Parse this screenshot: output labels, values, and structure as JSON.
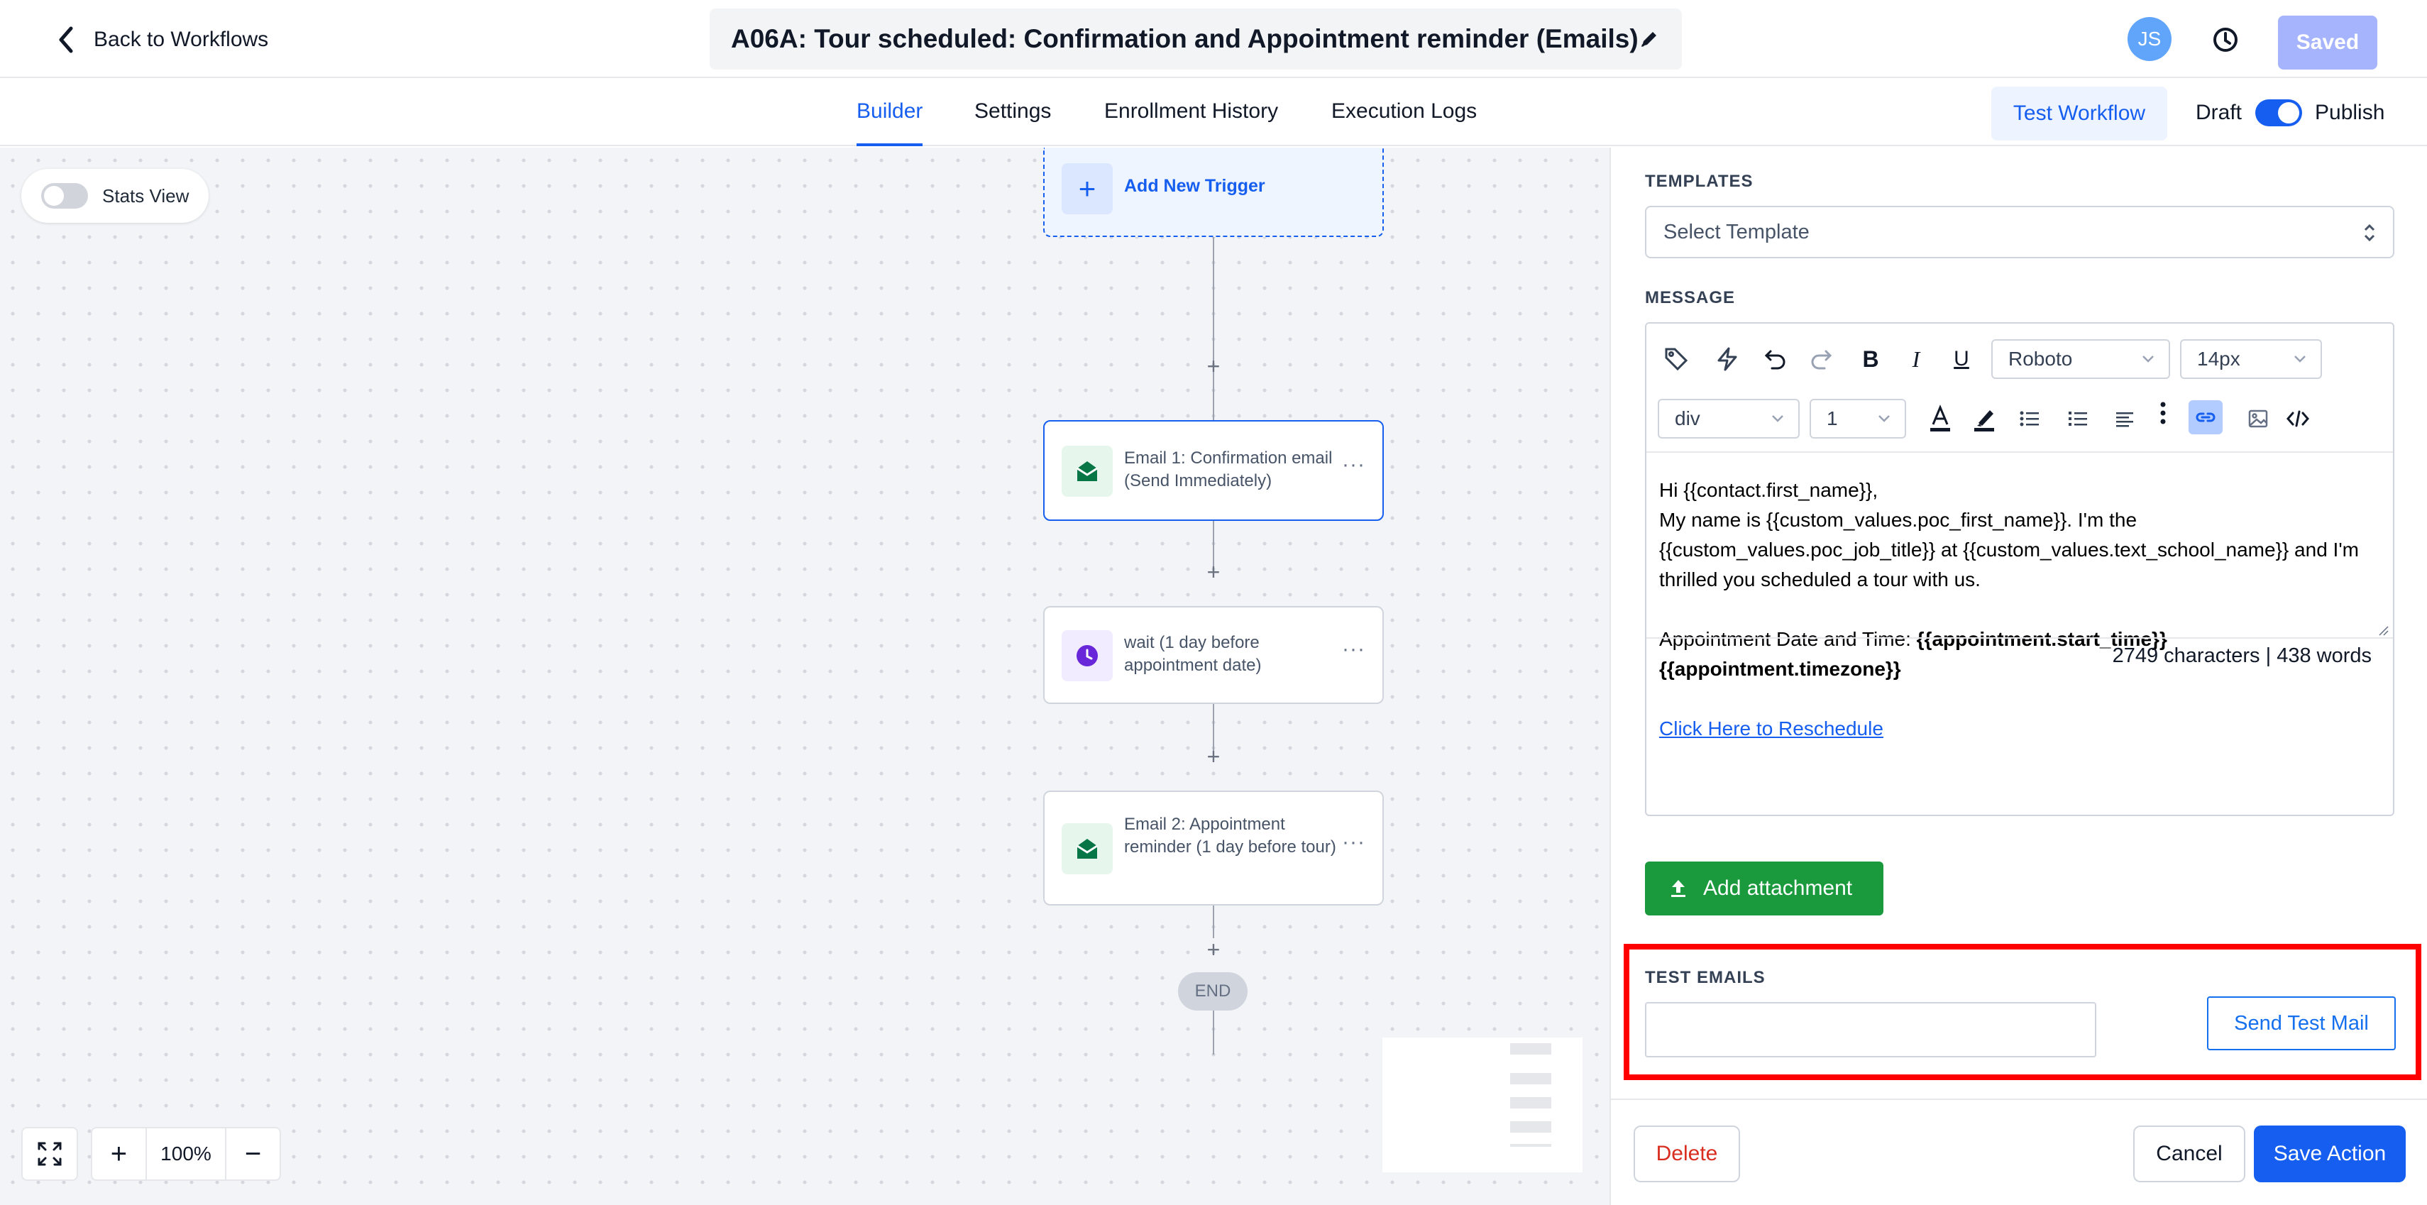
{
  "header": {
    "back_label": "Back to Workflows",
    "title": "A06A: Tour scheduled: Confirmation and Appointment reminder (Emails)",
    "avatar_initials": "JS",
    "saved_label": "Saved"
  },
  "tabs": [
    {
      "label": "Builder",
      "active": true
    },
    {
      "label": "Settings",
      "active": false
    },
    {
      "label": "Enrollment History",
      "active": false
    },
    {
      "label": "Execution Logs",
      "active": false
    }
  ],
  "tabbar_right": {
    "test_workflow_label": "Test Workflow",
    "draft_label": "Draft",
    "publish_label": "Publish",
    "published": true
  },
  "canvas": {
    "stats_view_label": "Stats View",
    "stats_view_on": false,
    "add_trigger_label": "Add New Trigger",
    "nodes": [
      {
        "text": "Email 1: Confirmation email (Send Immediately)",
        "icon": "email-icon",
        "selected": true
      },
      {
        "text": "wait (1 day before appointment date)",
        "icon": "clock-icon",
        "selected": false
      },
      {
        "text": "Email 2: Appointment reminder (1 day before tour)",
        "icon": "email-icon",
        "selected": false
      }
    ],
    "plus_symbol": "+",
    "more_symbol": "···",
    "end_label": "END",
    "zoom_level": "100%"
  },
  "panel": {
    "templates_label": "TEMPLATES",
    "template_placeholder": "Select Template",
    "message_label": "MESSAGE",
    "font_family_value": "Roboto",
    "font_size_value": "14px",
    "block_type_value": "div",
    "line_height_value": "1",
    "message_lines": {
      "greeting": "Hi {{contact.first_name}},",
      "intro_1": "My name is {{custom_values.poc_first_name}}. I'm the",
      "intro_2": "{{custom_values.poc_job_title}} at {{custom_values.text_school_name}} and I'm",
      "intro_3": "thrilled you scheduled a tour with us.",
      "appt_prefix": "Appointment Date and Time: ",
      "appt_time": "{{appointment.start_time}}",
      "appt_tz": "{{appointment.timezone}}",
      "reschedule_link": "Click Here to Reschedule"
    },
    "counts": "2749 characters | 438 words",
    "add_attachment_label": "Add attachment",
    "test_emails_label": "TEST EMAILS",
    "test_email_value": "",
    "send_test_label": "Send Test Mail",
    "delete_label": "Delete",
    "cancel_label": "Cancel",
    "save_label": "Save Action"
  },
  "colors": {
    "accent": "#155eef",
    "attach_green": "#1a9a3c",
    "highlight_red": "#ff0000",
    "delete_red": "#d92d20"
  }
}
